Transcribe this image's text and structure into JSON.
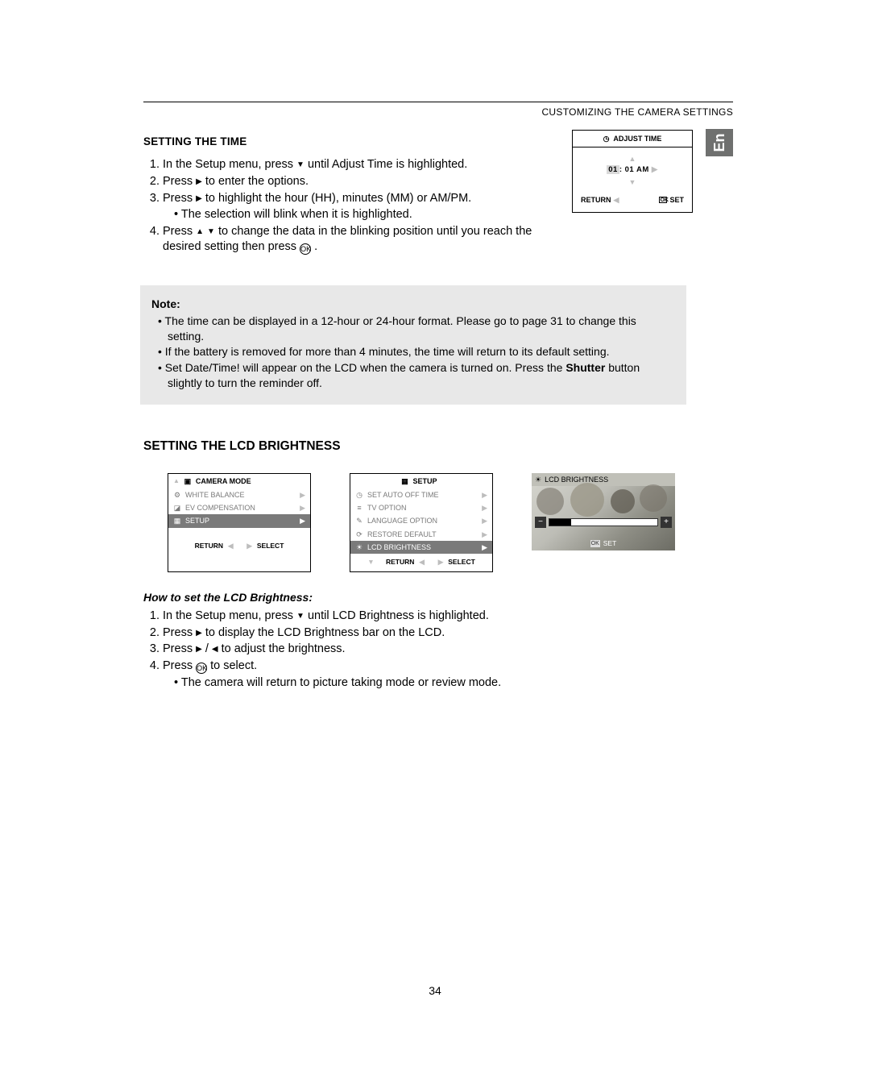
{
  "breadcrumb": "CUSTOMIZING THE CAMERA SETTINGS",
  "lang_tab": "En",
  "section_time": {
    "heading": "SETTING THE TIME",
    "steps": [
      {
        "pre": "In the Setup menu, press ",
        "icon": "▼",
        "post": " until Adjust Time is highlighted."
      },
      {
        "pre": "Press ",
        "icon": "▶",
        "post": "  to enter the options."
      },
      {
        "pre": "Press ",
        "icon": "▶",
        "post": "  to highlight the hour (HH), minutes (MM) or AM/PM.",
        "sub": "The selection will blink when it is highlighted."
      },
      {
        "pre": "Press ",
        "icon": "▲",
        "icon2": "▼",
        "post": " to change the data in the blinking position until you reach the desired setting then press ",
        "ok": "OK",
        "post2": " ."
      }
    ],
    "lcd": {
      "title": "ADJUST  TIME",
      "hh": "01",
      "rest": ": 01 AM",
      "return": "RETURN",
      "set": "SET"
    }
  },
  "note": {
    "title": "Note:",
    "items": [
      "The time can be displayed in a 12-hour or 24-hour format. Please go to page 31 to change this setting.",
      "If the battery is removed for more than 4 minutes, the time will return to its default setting."
    ],
    "item3_pre": "Set Date/Time! will appear on the LCD when the camera is turned on. Press the ",
    "item3_bold": "Shutter",
    "item3_post": " button slightly to turn the reminder off."
  },
  "section_lcd": {
    "heading": "SETTING THE LCD BRIGHTNESS",
    "menu1": {
      "title": "CAMERA MODE",
      "items": [
        "WHITE BALANCE",
        "EV COMPENSATION",
        "SETUP"
      ],
      "hl_index": 2,
      "return": "RETURN",
      "select": "SELECT"
    },
    "menu2": {
      "title": "SETUP",
      "items": [
        "SET AUTO OFF TIME",
        "TV OPTION",
        "LANGUAGE OPTION",
        "RESTORE DEFAULT",
        "LCD BRIGHTNESS"
      ],
      "hl_index": 4,
      "return": "RETURN",
      "select": "SELECT"
    },
    "imgbox": {
      "title": "LCD BRIGHTNESS",
      "set": "SET"
    },
    "howto_title": "How to set the LCD Brightness:",
    "steps": [
      {
        "pre": "In the Setup menu, press ",
        "icon": "▼",
        "post": " until LCD Brightness is highlighted."
      },
      {
        "pre": "Press ",
        "icon": "▶",
        "post": " to display the LCD Brightness bar on the LCD."
      },
      {
        "pre": "Press ",
        "icon": "▶",
        "mid": "  /  ",
        "icon2": "◀",
        "post": " to adjust the brightness."
      },
      {
        "pre": "Press ",
        "ok": "OK",
        "post": " to select.",
        "sub": "The camera will return to picture taking mode or review mode."
      }
    ]
  },
  "page_num": "34"
}
